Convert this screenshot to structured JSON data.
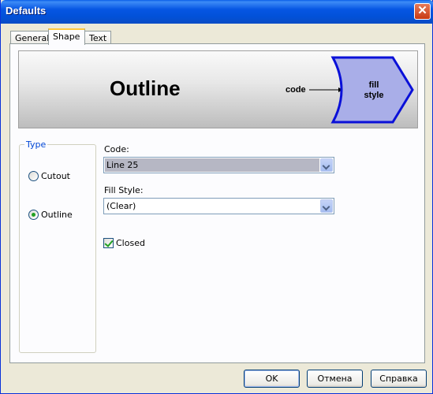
{
  "window": {
    "title": "Defaults",
    "close_symbol": "✕"
  },
  "tabs": [
    {
      "label": "General"
    },
    {
      "label": "Shape"
    },
    {
      "label": "Text"
    }
  ],
  "preview": {
    "title": "Outline",
    "code_label": "code",
    "fill_label_1": "fill",
    "fill_label_2": "style",
    "shape_fill": "#a9aee8",
    "shape_stroke": "#0a10d8"
  },
  "type_group": {
    "legend": "Type",
    "options": [
      {
        "label": "Cutout",
        "checked": false
      },
      {
        "label": "Outline",
        "checked": true
      }
    ]
  },
  "code": {
    "label": "Code:",
    "value": "Line 25"
  },
  "fill_style": {
    "label": "Fill Style:",
    "value": "(Clear)"
  },
  "closed": {
    "label": "Closed",
    "checked": true
  },
  "buttons": {
    "ok": "OK",
    "cancel": "Отмена",
    "help": "Справка"
  },
  "colors": {
    "title_bar": "#0a4cc5",
    "tab_highlight": "#ffc83c",
    "legend_text": "#0046d5"
  }
}
